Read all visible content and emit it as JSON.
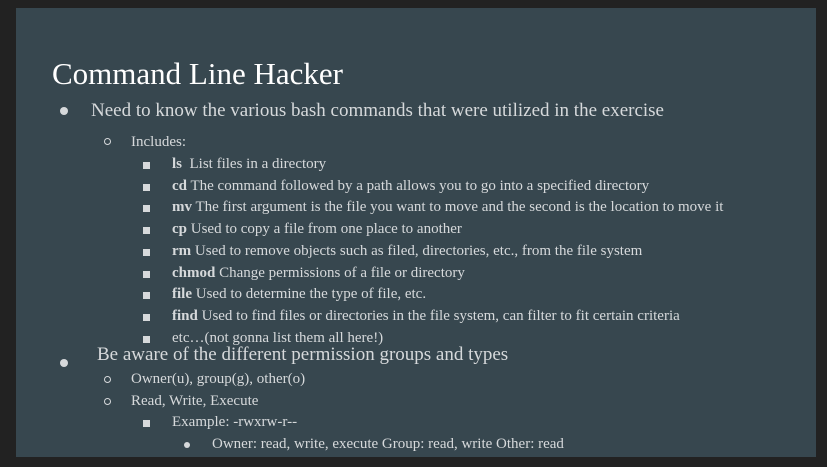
{
  "slide": {
    "title": "Command Line Hacker",
    "bullet1": "Need to know the various bash commands that were utilized in the exercise",
    "includes": "Includes:",
    "commands": [
      {
        "cmd": "ls",
        "desc": "  List files in a directory"
      },
      {
        "cmd": "cd",
        "desc": " The command followed by a path allows you to go into a specified directory"
      },
      {
        "cmd": "mv",
        "desc": " The first argument is the file you want to move and the second is the location to move it"
      },
      {
        "cmd": "cp",
        "desc": " Used to copy a file from one place to another"
      },
      {
        "cmd": "rm",
        "desc": " Used to remove objects such as filed, directories, etc., from the file system"
      },
      {
        "cmd": "chmod",
        "desc": " Change permissions of a file or directory"
      },
      {
        "cmd": "file",
        "desc": " Used to determine the type of file, etc."
      },
      {
        "cmd": "find",
        "desc": " Used to find files or directories in the file system, can filter to fit certain criteria"
      },
      {
        "cmd": "",
        "desc": "etc…(not gonna list them all here!)"
      }
    ],
    "bullet2": "Be aware of the different permission groups and types",
    "groups": "Owner(u), group(g), other(o)",
    "types": "Read, Write, Execute",
    "example": "Example: -rwxrw-r--",
    "example_detail": "Owner: read, write, execute Group: read, write Other: read"
  },
  "colors": {
    "background": "#222222",
    "slide": "#37474f",
    "title": "#ffffff",
    "text": "#d6d9db"
  }
}
